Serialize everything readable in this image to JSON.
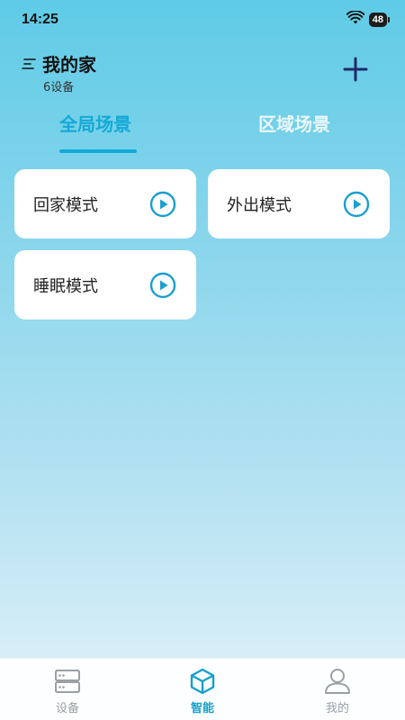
{
  "status_bar": {
    "time": "14:25",
    "battery": "48"
  },
  "header": {
    "home_name": "我的家",
    "device_count": "6设备"
  },
  "tabs": [
    {
      "label": "全局场景",
      "active": true
    },
    {
      "label": "区域场景",
      "active": false
    }
  ],
  "scenes": [
    {
      "label": "回家模式"
    },
    {
      "label": "外出模式"
    },
    {
      "label": "睡眠模式"
    }
  ],
  "bottom_nav": [
    {
      "label": "设备",
      "icon": "device-icon",
      "active": false
    },
    {
      "label": "智能",
      "icon": "cube-icon",
      "active": true
    },
    {
      "label": "我的",
      "icon": "user-icon",
      "active": false
    }
  ],
  "colors": {
    "accent": "#14a9d6",
    "play": "#1a9fcf"
  }
}
